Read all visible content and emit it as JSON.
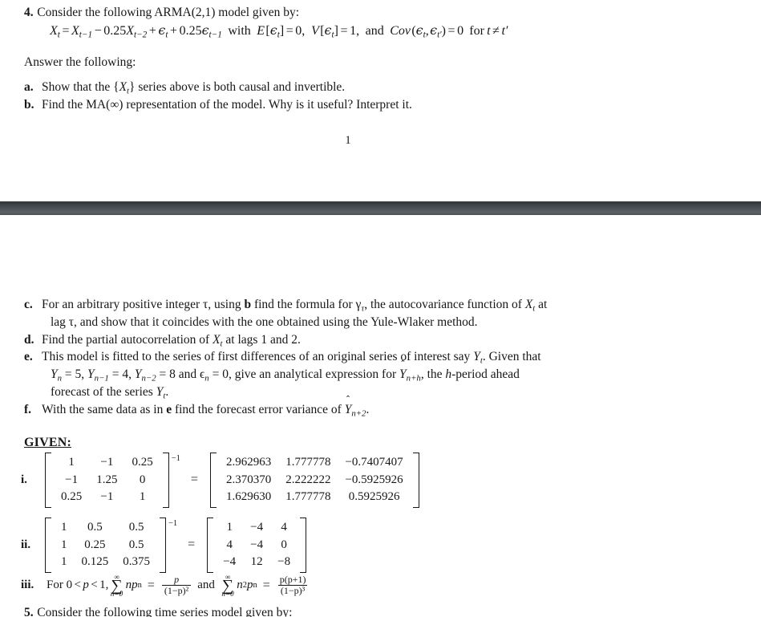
{
  "document": {
    "page_number": "1"
  },
  "question": {
    "label": "4.",
    "prompt": "Consider the following ARMA(2,1) model given by:",
    "equation": {
      "lhs": "X",
      "lhs_sub": "t",
      "terms": "X_{t-1} - 0.25X_{t-2} + ϵ_t + 0.25ϵ_{t-1}",
      "with_text": "with",
      "moment_mean": "E [ϵ_t] = 0,",
      "moment_var": "V [ϵ_t] = 1,",
      "and_text": "and",
      "moment_cov": "Cov (ϵ_t, ϵ_t′) = 0 for t ≠ t′",
      "coef_ar2": "0.25",
      "coef_ma1": "0.25",
      "mean_value": "0",
      "var_value": "1",
      "cov_value": "0"
    },
    "answer_line": "Answer the following:"
  },
  "items": {
    "a": {
      "label": "a.",
      "text_1": "Show that the {",
      "sym": "X",
      "sym_sub": "t",
      "text_2": "} series above is both causal and invertible."
    },
    "b": {
      "label": "b.",
      "text_1": "Find the MA(∞) representation of the model. Why is it useful? Interpret it."
    },
    "c": {
      "label": "c.",
      "text_1": "For an arbitrary positive integer τ, using ",
      "bold_ref": "b",
      "text_2": " find the formula for γ",
      "gamma_sub": "τ",
      "text_3": ", the autocovariance function of ",
      "sym": "X",
      "sym_sub": "t",
      "text_4": " at",
      "cont": "lag τ, and show that it coincides with the one obtained using the Yule-Wlaker method."
    },
    "d": {
      "label": "d.",
      "text_1": "Find the partial autocorrelation of ",
      "sym": "X",
      "sym_sub": "t",
      "text_2": " at lags 1 and 2."
    },
    "e": {
      "label": "e.",
      "text_1": "This model is fitted to the series of first differences of an original series of interest say ",
      "sym": "Y",
      "sym_sub": "t",
      "text_2": ". Given that",
      "cont_1_a": "Y",
      "cont_1_a_sub": "n",
      "cont_1_b": " = 5, ",
      "cont_1_c": "Y",
      "cont_1_c_sub": "n−1",
      "cont_1_d": " = 4, ",
      "cont_1_e": "Y",
      "cont_1_e_sub": "n−2",
      "cont_1_f": " = 8 and ϵ",
      "cont_1_g_sub": "n",
      "cont_1_h": " = 0, give an analytical expression for ",
      "cont_1_hat": "Y",
      "cont_1_hat_sub": "n+h",
      "cont_1_i": ", the ",
      "cont_1_j": "h",
      "cont_1_k": "-period ahead",
      "cont_2": "forecast of the series ",
      "cont_2_sym": "Y",
      "cont_2_sym_sub": "t",
      "cont_2_end": ".",
      "values": {
        "Y_n": "5",
        "Y_n_minus_1": "4",
        "Y_n_minus_2": "8",
        "eps_n": "0"
      }
    },
    "f": {
      "label": "f.",
      "text_1": "With the same data as in ",
      "bold_ref": "e",
      "text_2": " find the forecast error variance of ",
      "hat_sym": "Y",
      "hat_sub": "n+2",
      "text_3": "."
    }
  },
  "given": {
    "heading": "GIVEN:",
    "matrix_i": {
      "label": "i.",
      "exponent": "−1",
      "equals": "=",
      "left": [
        [
          "1",
          "−1",
          "0.25"
        ],
        [
          "−1",
          "1.25",
          "0"
        ],
        [
          "0.25",
          "−1",
          "1"
        ]
      ],
      "right": [
        [
          "2.962963",
          "1.777778",
          "−0.7407407"
        ],
        [
          "2.370370",
          "2.222222",
          "−0.5925926"
        ],
        [
          "1.629630",
          "1.777778",
          "0.5925926"
        ]
      ]
    },
    "matrix_ii": {
      "label": "ii.",
      "exponent": "−1",
      "equals": "=",
      "left": [
        [
          "1",
          "0.5",
          "0.5"
        ],
        [
          "1",
          "0.25",
          "0.5"
        ],
        [
          "1",
          "0.125",
          "0.375"
        ]
      ],
      "right": [
        [
          "1",
          "−4",
          "4"
        ],
        [
          "4",
          "−4",
          "0"
        ],
        [
          "−4",
          "12",
          "−8"
        ]
      ]
    },
    "series": {
      "label": "iii.",
      "text_1": "For 0 < p < 1,",
      "sum_upper": "∞",
      "sum_lower_1": "n=0",
      "sum_body_1": "np",
      "sum_body_1_exp": "n",
      "equals_1": "=",
      "frac_1_num": "p",
      "frac_1_den": "(1−p)²",
      "and_text": "and",
      "sum_lower_2": "n=0",
      "sum_body_2": "n",
      "sum_body_2_exp_a": "2",
      "sum_body_2_b": "p",
      "sum_body_2_exp_b": "n",
      "equals_2": "=",
      "frac_2_num": "p(p+1)",
      "frac_2_den": "(1−p)³"
    }
  },
  "next_question": {
    "label": "5.",
    "text": "Consider the following time series model given by:"
  }
}
